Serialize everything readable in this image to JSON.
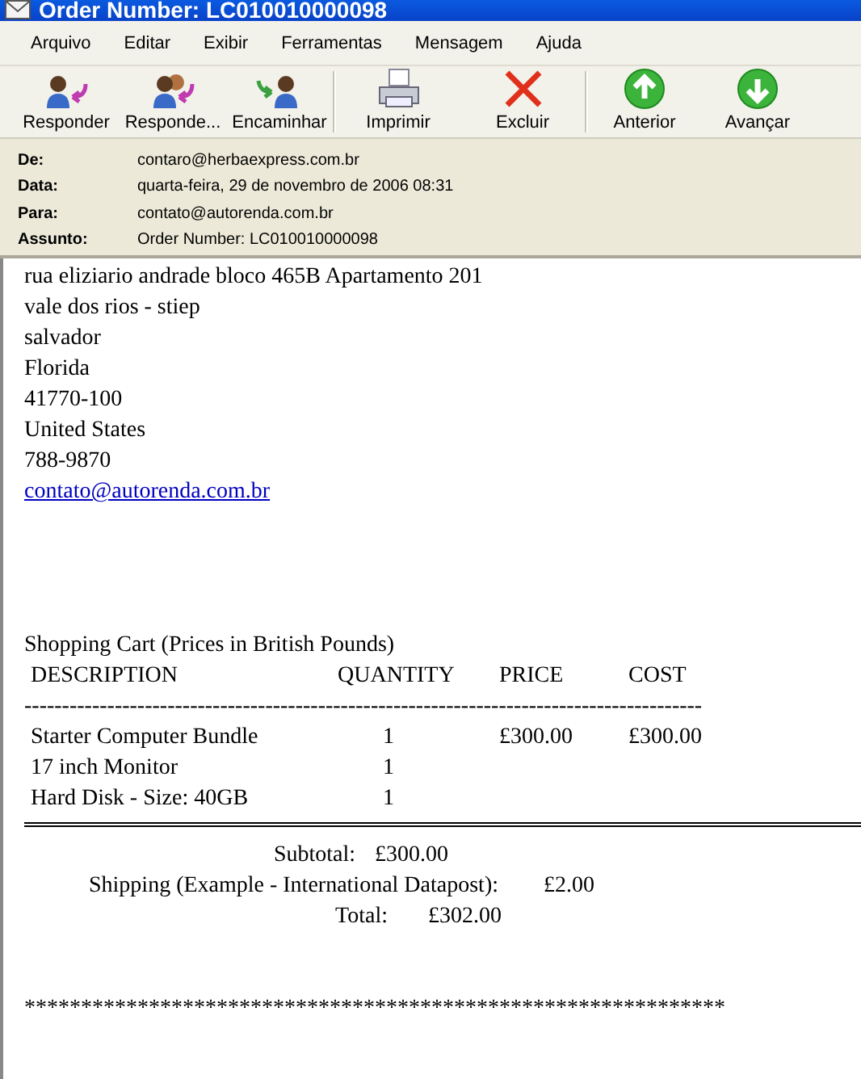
{
  "window": {
    "title": "Order Number: LC010010000098"
  },
  "menu": [
    "Arquivo",
    "Editar",
    "Exibir",
    "Ferramentas",
    "Mensagem",
    "Ajuda"
  ],
  "toolbar": [
    {
      "label": "Responder",
      "kind": "reply"
    },
    {
      "label": "Responde...",
      "kind": "reply-all"
    },
    {
      "label": "Encaminhar",
      "kind": "forward"
    },
    {
      "label": "Imprimir",
      "kind": "print"
    },
    {
      "label": "Excluir",
      "kind": "delete"
    },
    {
      "label": "Anterior",
      "kind": "previous"
    },
    {
      "label": "Avançar",
      "kind": "next"
    }
  ],
  "header": [
    {
      "label": "De:",
      "value": "contaro@herbaexpress.com.br"
    },
    {
      "label": "Data:",
      "value": "quarta-feira, 29 de novembro de 2006 08:31"
    },
    {
      "label": "Para:",
      "value": "contato@autorenda.com.br"
    },
    {
      "label": "Assunto:",
      "value": "Order Number: LC010010000098"
    }
  ],
  "body": {
    "address_lines": [
      "rua eliziario andrade bloco 465B Apartamento 201",
      "vale dos rios - stiep",
      "salvador",
      "Florida",
      "41770-100",
      "United States",
      "788-9870"
    ],
    "email_link": "contato@autorenda.com.br",
    "cart_title": "Shopping Cart (Prices in British Pounds)",
    "columns": [
      "DESCRIPTION",
      "QUANTITY",
      "PRICE",
      "COST"
    ],
    "separator": "------------------------------------------------------------------------------------------",
    "rows": [
      [
        "Starter Computer Bundle",
        "1",
        "£300.00",
        "£300.00"
      ],
      [
        "17 inch Monitor",
        "1",
        "",
        ""
      ],
      [
        "Hard Disk - Size: 40GB",
        "1",
        "",
        ""
      ]
    ],
    "totals": [
      {
        "label": "Subtotal:",
        "value": "£300.00"
      },
      {
        "label": "Shipping (Example - International Datapost):",
        "value": "£2.00"
      },
      {
        "label": "Total:",
        "value": "£302.00"
      }
    ],
    "footer_line": "**************************************************************"
  }
}
